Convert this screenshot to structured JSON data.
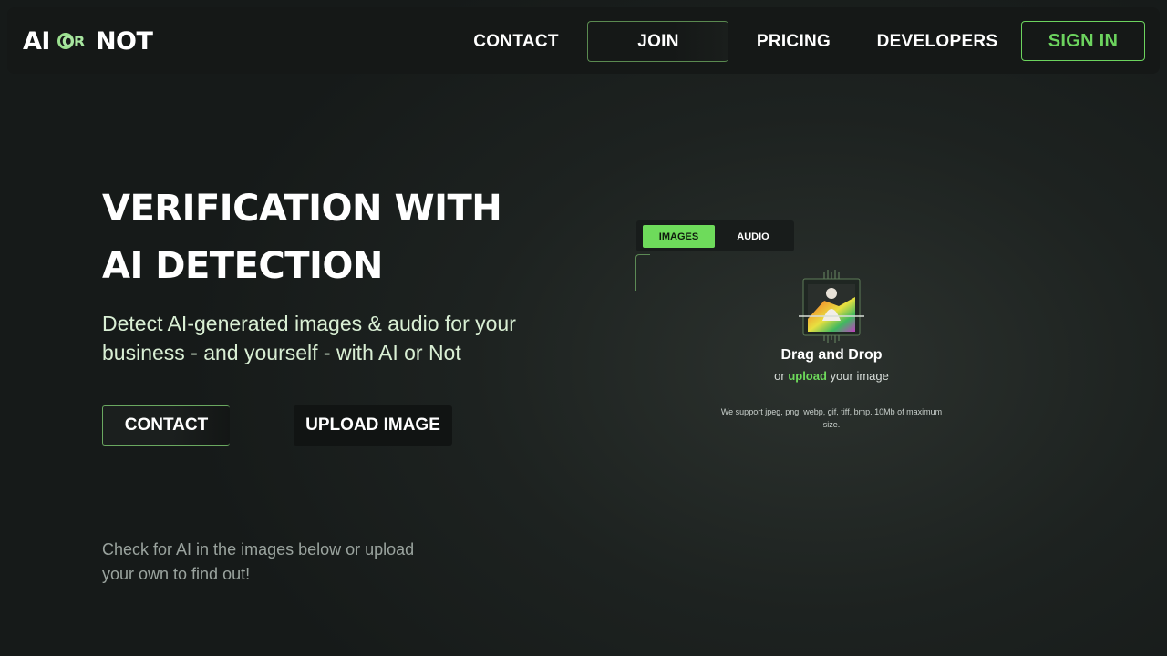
{
  "nav": {
    "logo": {
      "ai": "AI",
      "or": "OR",
      "not": "NOT"
    },
    "contact": "CONTACT",
    "join": "JOIN",
    "pricing": "PRICING",
    "developers": "DEVELOPERS",
    "signin": "SIGN IN"
  },
  "hero": {
    "title_line1": "VERIFICATION WITH",
    "title_line2": "AI DETECTION",
    "subtitle": "Detect AI-generated images & audio for your business - and yourself - with AI or Not",
    "contact_button": "CONTACT",
    "upload_button": "UPLOAD IMAGE",
    "hint": "Check for AI in the images below or upload your own to find out!"
  },
  "uploader": {
    "tabs": [
      {
        "label": "IMAGES",
        "active": true
      },
      {
        "label": "AUDIO",
        "active": false
      }
    ],
    "drop_title": "Drag and Drop",
    "drop_prefix": "or",
    "drop_link": "upload",
    "drop_suffix": "your image",
    "support": "We support jpeg, png, webp, gif, tiff, bmp. 10Mb of maximum size.",
    "icon": "image-scan-icon"
  },
  "colors": {
    "accent": "#6edb5b",
    "background": "#1d2220",
    "navbar": "#151817"
  }
}
